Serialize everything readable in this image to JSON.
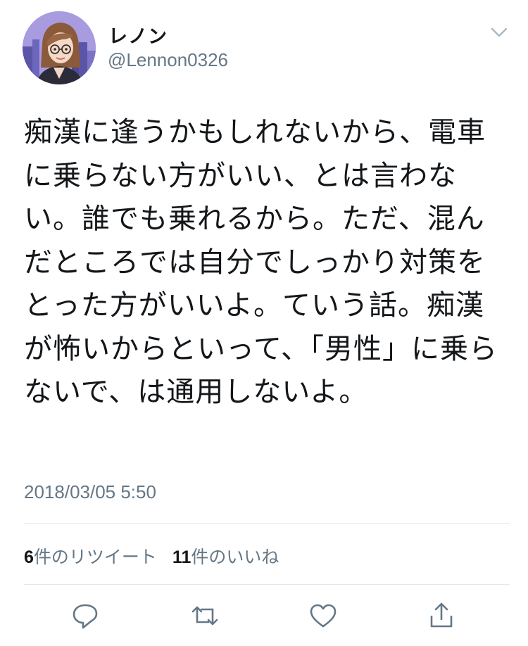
{
  "tweet": {
    "display_name": "レノン",
    "handle": "@Lennon0326",
    "text": "痴漢に逢うかもしれないから、電車に乗らない方がいい、とは言わない。誰でも乗れるから。ただ、混んだところでは自分でしっかり対策をとった方がいいよ。ていう話。痴漢が怖いからといって、「男性」に乗らないで、は通用しないよ。",
    "timestamp": "2018/03/05 5:50"
  },
  "stats": {
    "retweets_count": "6",
    "retweets_label": "件のリツイート",
    "likes_count": "11",
    "likes_label": "件のいいね"
  },
  "icons": {
    "menu": "chevron-down-icon",
    "reply": "reply-icon",
    "retweet": "retweet-icon",
    "like": "heart-icon",
    "share": "share-icon"
  },
  "colors": {
    "text": "#14171a",
    "secondary": "#657786",
    "divider": "#e1e8ed"
  }
}
